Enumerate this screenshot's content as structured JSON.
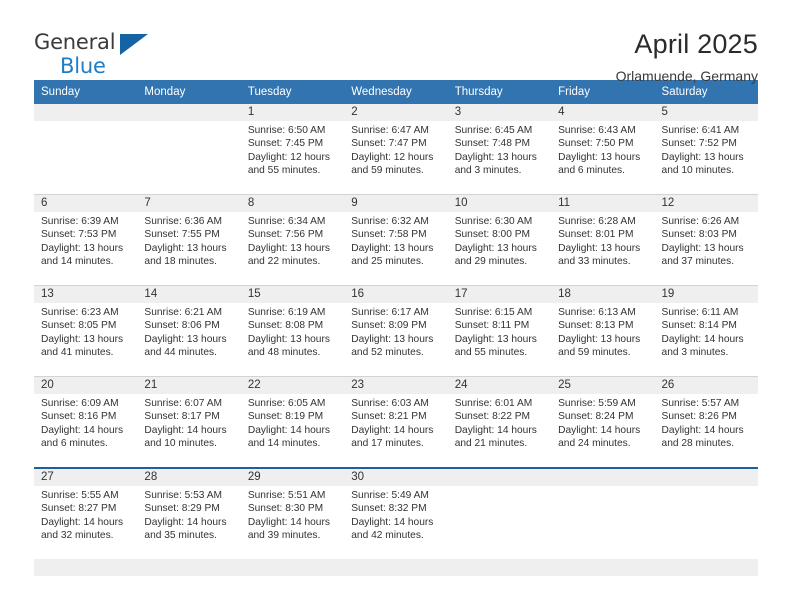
{
  "logo": {
    "word1": "General",
    "word2": "Blue",
    "triangle_color": "#1464a5",
    "blue_color": "#1f7dc4"
  },
  "header": {
    "title": "April 2025",
    "subtitle": "Orlamuende, Germany"
  },
  "theme": {
    "header_blue": "#3174b0",
    "band_gray": "#efefef",
    "rule_blue": "#1f5f9e",
    "row_divider": "#d3d3d3"
  },
  "calendar": {
    "weekday_headers": [
      "Sunday",
      "Monday",
      "Tuesday",
      "Wednesday",
      "Thursday",
      "Friday",
      "Saturday"
    ],
    "weeks": [
      [
        {
          "day": "",
          "sunrise": "",
          "sunset": "",
          "daylight1": "",
          "daylight2": ""
        },
        {
          "day": "",
          "sunrise": "",
          "sunset": "",
          "daylight1": "",
          "daylight2": ""
        },
        {
          "day": "1",
          "sunrise": "Sunrise: 6:50 AM",
          "sunset": "Sunset: 7:45 PM",
          "daylight1": "Daylight: 12 hours",
          "daylight2": "and 55 minutes."
        },
        {
          "day": "2",
          "sunrise": "Sunrise: 6:47 AM",
          "sunset": "Sunset: 7:47 PM",
          "daylight1": "Daylight: 12 hours",
          "daylight2": "and 59 minutes."
        },
        {
          "day": "3",
          "sunrise": "Sunrise: 6:45 AM",
          "sunset": "Sunset: 7:48 PM",
          "daylight1": "Daylight: 13 hours",
          "daylight2": "and 3 minutes."
        },
        {
          "day": "4",
          "sunrise": "Sunrise: 6:43 AM",
          "sunset": "Sunset: 7:50 PM",
          "daylight1": "Daylight: 13 hours",
          "daylight2": "and 6 minutes."
        },
        {
          "day": "5",
          "sunrise": "Sunrise: 6:41 AM",
          "sunset": "Sunset: 7:52 PM",
          "daylight1": "Daylight: 13 hours",
          "daylight2": "and 10 minutes."
        }
      ],
      [
        {
          "day": "6",
          "sunrise": "Sunrise: 6:39 AM",
          "sunset": "Sunset: 7:53 PM",
          "daylight1": "Daylight: 13 hours",
          "daylight2": "and 14 minutes."
        },
        {
          "day": "7",
          "sunrise": "Sunrise: 6:36 AM",
          "sunset": "Sunset: 7:55 PM",
          "daylight1": "Daylight: 13 hours",
          "daylight2": "and 18 minutes."
        },
        {
          "day": "8",
          "sunrise": "Sunrise: 6:34 AM",
          "sunset": "Sunset: 7:56 PM",
          "daylight1": "Daylight: 13 hours",
          "daylight2": "and 22 minutes."
        },
        {
          "day": "9",
          "sunrise": "Sunrise: 6:32 AM",
          "sunset": "Sunset: 7:58 PM",
          "daylight1": "Daylight: 13 hours",
          "daylight2": "and 25 minutes."
        },
        {
          "day": "10",
          "sunrise": "Sunrise: 6:30 AM",
          "sunset": "Sunset: 8:00 PM",
          "daylight1": "Daylight: 13 hours",
          "daylight2": "and 29 minutes."
        },
        {
          "day": "11",
          "sunrise": "Sunrise: 6:28 AM",
          "sunset": "Sunset: 8:01 PM",
          "daylight1": "Daylight: 13 hours",
          "daylight2": "and 33 minutes."
        },
        {
          "day": "12",
          "sunrise": "Sunrise: 6:26 AM",
          "sunset": "Sunset: 8:03 PM",
          "daylight1": "Daylight: 13 hours",
          "daylight2": "and 37 minutes."
        }
      ],
      [
        {
          "day": "13",
          "sunrise": "Sunrise: 6:23 AM",
          "sunset": "Sunset: 8:05 PM",
          "daylight1": "Daylight: 13 hours",
          "daylight2": "and 41 minutes."
        },
        {
          "day": "14",
          "sunrise": "Sunrise: 6:21 AM",
          "sunset": "Sunset: 8:06 PM",
          "daylight1": "Daylight: 13 hours",
          "daylight2": "and 44 minutes."
        },
        {
          "day": "15",
          "sunrise": "Sunrise: 6:19 AM",
          "sunset": "Sunset: 8:08 PM",
          "daylight1": "Daylight: 13 hours",
          "daylight2": "and 48 minutes."
        },
        {
          "day": "16",
          "sunrise": "Sunrise: 6:17 AM",
          "sunset": "Sunset: 8:09 PM",
          "daylight1": "Daylight: 13 hours",
          "daylight2": "and 52 minutes."
        },
        {
          "day": "17",
          "sunrise": "Sunrise: 6:15 AM",
          "sunset": "Sunset: 8:11 PM",
          "daylight1": "Daylight: 13 hours",
          "daylight2": "and 55 minutes."
        },
        {
          "day": "18",
          "sunrise": "Sunrise: 6:13 AM",
          "sunset": "Sunset: 8:13 PM",
          "daylight1": "Daylight: 13 hours",
          "daylight2": "and 59 minutes."
        },
        {
          "day": "19",
          "sunrise": "Sunrise: 6:11 AM",
          "sunset": "Sunset: 8:14 PM",
          "daylight1": "Daylight: 14 hours",
          "daylight2": "and 3 minutes."
        }
      ],
      [
        {
          "day": "20",
          "sunrise": "Sunrise: 6:09 AM",
          "sunset": "Sunset: 8:16 PM",
          "daylight1": "Daylight: 14 hours",
          "daylight2": "and 6 minutes."
        },
        {
          "day": "21",
          "sunrise": "Sunrise: 6:07 AM",
          "sunset": "Sunset: 8:17 PM",
          "daylight1": "Daylight: 14 hours",
          "daylight2": "and 10 minutes."
        },
        {
          "day": "22",
          "sunrise": "Sunrise: 6:05 AM",
          "sunset": "Sunset: 8:19 PM",
          "daylight1": "Daylight: 14 hours",
          "daylight2": "and 14 minutes."
        },
        {
          "day": "23",
          "sunrise": "Sunrise: 6:03 AM",
          "sunset": "Sunset: 8:21 PM",
          "daylight1": "Daylight: 14 hours",
          "daylight2": "and 17 minutes."
        },
        {
          "day": "24",
          "sunrise": "Sunrise: 6:01 AM",
          "sunset": "Sunset: 8:22 PM",
          "daylight1": "Daylight: 14 hours",
          "daylight2": "and 21 minutes."
        },
        {
          "day": "25",
          "sunrise": "Sunrise: 5:59 AM",
          "sunset": "Sunset: 8:24 PM",
          "daylight1": "Daylight: 14 hours",
          "daylight2": "and 24 minutes."
        },
        {
          "day": "26",
          "sunrise": "Sunrise: 5:57 AM",
          "sunset": "Sunset: 8:26 PM",
          "daylight1": "Daylight: 14 hours",
          "daylight2": "and 28 minutes."
        }
      ],
      [
        {
          "day": "27",
          "sunrise": "Sunrise: 5:55 AM",
          "sunset": "Sunset: 8:27 PM",
          "daylight1": "Daylight: 14 hours",
          "daylight2": "and 32 minutes."
        },
        {
          "day": "28",
          "sunrise": "Sunrise: 5:53 AM",
          "sunset": "Sunset: 8:29 PM",
          "daylight1": "Daylight: 14 hours",
          "daylight2": "and 35 minutes."
        },
        {
          "day": "29",
          "sunrise": "Sunrise: 5:51 AM",
          "sunset": "Sunset: 8:30 PM",
          "daylight1": "Daylight: 14 hours",
          "daylight2": "and 39 minutes."
        },
        {
          "day": "30",
          "sunrise": "Sunrise: 5:49 AM",
          "sunset": "Sunset: 8:32 PM",
          "daylight1": "Daylight: 14 hours",
          "daylight2": "and 42 minutes."
        },
        {
          "day": "",
          "sunrise": "",
          "sunset": "",
          "daylight1": "",
          "daylight2": ""
        },
        {
          "day": "",
          "sunrise": "",
          "sunset": "",
          "daylight1": "",
          "daylight2": ""
        },
        {
          "day": "",
          "sunrise": "",
          "sunset": "",
          "daylight1": "",
          "daylight2": ""
        }
      ]
    ]
  }
}
